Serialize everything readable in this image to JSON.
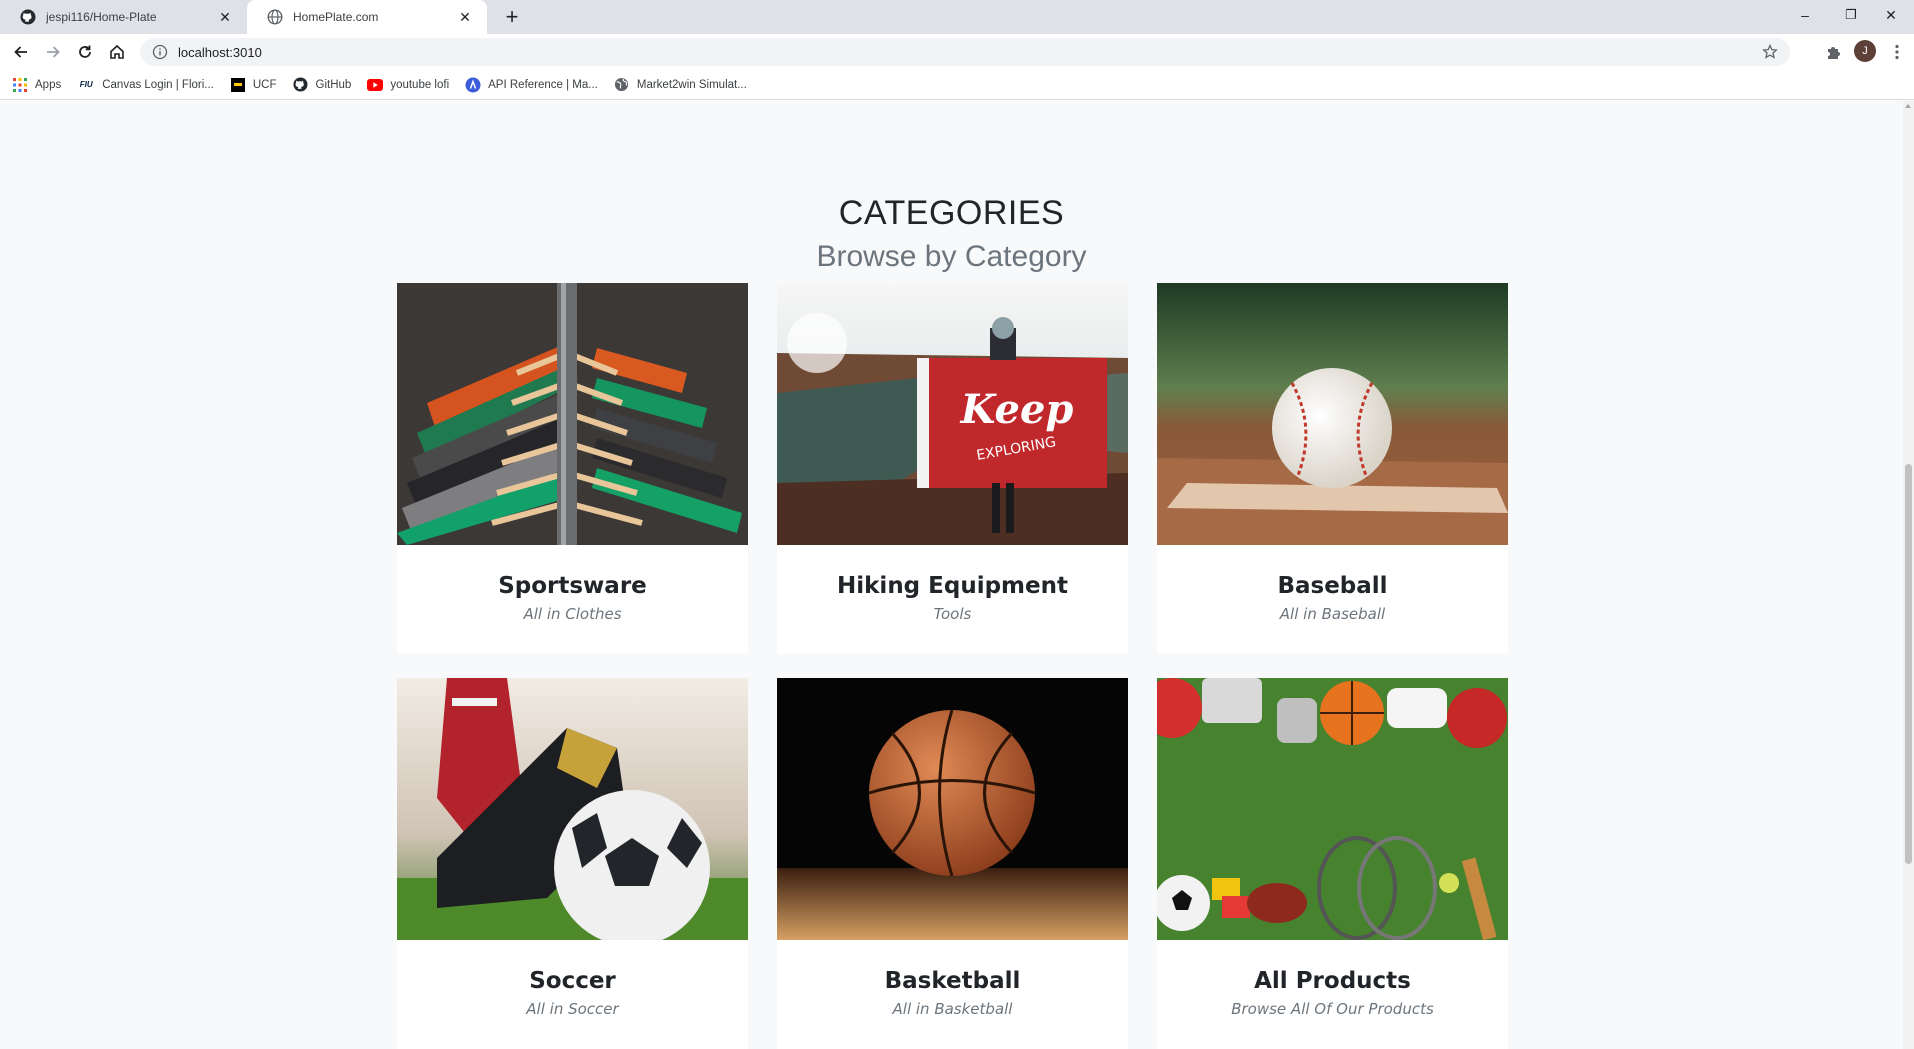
{
  "browser": {
    "tabs": [
      {
        "title": "jespi116/Home-Plate",
        "icon": "github-icon"
      },
      {
        "title": "HomePlate.com",
        "icon": "globe-icon"
      }
    ],
    "new_tab": "+",
    "url": "localhost:3010",
    "avatar_letter": "J",
    "window_controls": {
      "minimize": "–",
      "restore": "❐",
      "close": "✕"
    },
    "bookmarks": [
      {
        "label": "Apps",
        "icon": "apps-grid-icon"
      },
      {
        "label": "Canvas Login | Flori...",
        "icon": "fiu-icon",
        "icon_text": "FIU"
      },
      {
        "label": "UCF",
        "icon": "ucf-icon"
      },
      {
        "label": "GitHub",
        "icon": "github-icon"
      },
      {
        "label": "youtube lofi",
        "icon": "youtube-icon"
      },
      {
        "label": "API Reference | Ma...",
        "icon": "api-icon"
      },
      {
        "label": "Market2win Simulat...",
        "icon": "globe-icon"
      }
    ]
  },
  "page": {
    "title": "CATEGORIES",
    "subtitle": "Browse by Category",
    "categories": [
      {
        "name": "Sportsware",
        "subtitle": "All in Clothes",
        "image": "clothes-rack-image"
      },
      {
        "name": "Hiking Equipment",
        "subtitle": "Tools",
        "image": "hiker-flag-image",
        "image_text_1": "Keep",
        "image_text_2": "EXPLORING"
      },
      {
        "name": "Baseball",
        "subtitle": "All in Baseball",
        "image": "baseball-image"
      },
      {
        "name": "Soccer",
        "subtitle": "All in Soccer",
        "image": "soccer-ball-image"
      },
      {
        "name": "Basketball",
        "subtitle": "All in Basketball",
        "image": "basketball-image"
      },
      {
        "name": "All Products",
        "subtitle": "Browse All Of Our Products",
        "image": "sports-equipment-image"
      }
    ]
  },
  "colors": {
    "page_bg": "#f8f9fa",
    "heading": "#212529",
    "muted": "#6c757d",
    "tabstrip": "#dee1e6"
  }
}
